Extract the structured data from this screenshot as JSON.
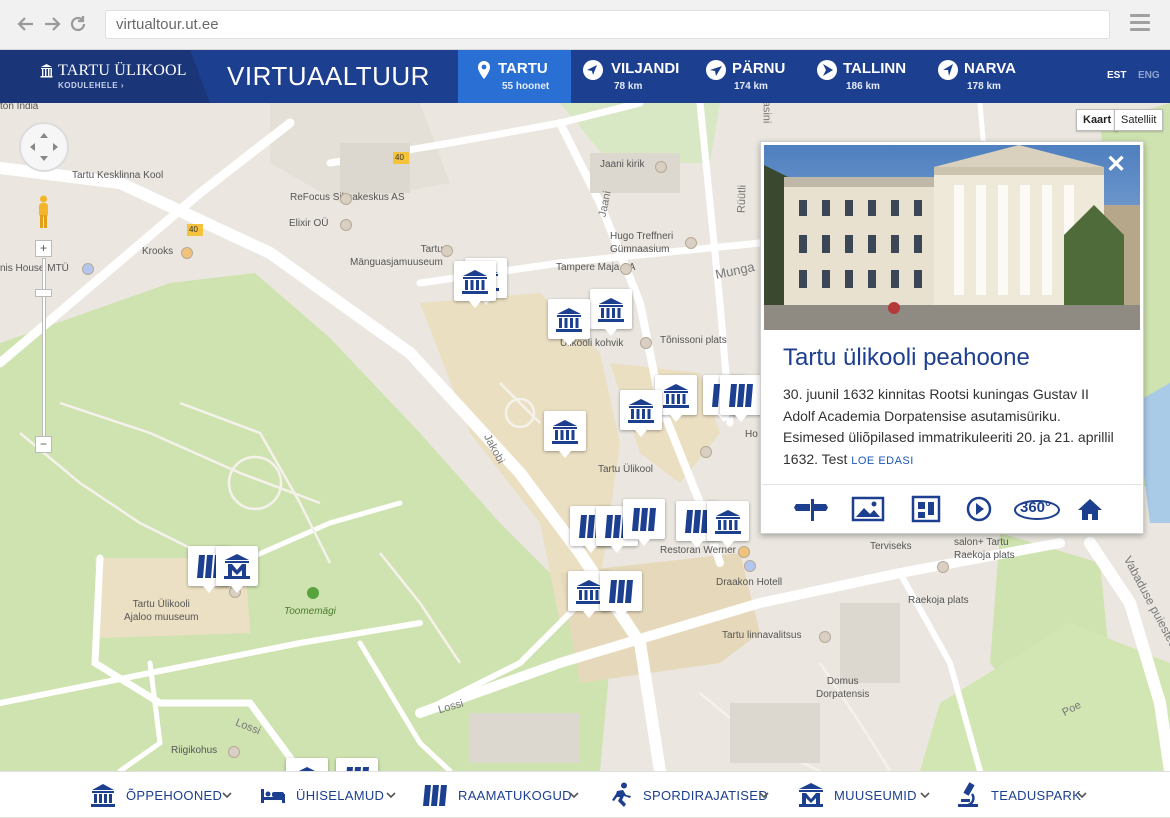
{
  "browser": {
    "url": "virtualtour.ut.ee"
  },
  "header": {
    "logo_title": "TARTU ÜLIKOOL",
    "logo_sub": "KODULEHELE ›",
    "site_title": "VIRTUAALTUUR",
    "cities": [
      {
        "name": "TARTU",
        "sub": "55 hoonet",
        "active": true
      },
      {
        "name": "VILJANDI",
        "sub": "78 km"
      },
      {
        "name": "PÄRNU",
        "sub": "174 km"
      },
      {
        "name": "TALLINN",
        "sub": "186 km"
      },
      {
        "name": "NARVA",
        "sub": "178 km"
      }
    ],
    "lang_est": "EST",
    "lang_eng": "ENG"
  },
  "map": {
    "map_type_map": "Kaart",
    "map_type_satellite": "Satelliit",
    "zoom_in": "+",
    "zoom_out": "−",
    "road_number": "40",
    "labels": {
      "toomemagi": "Toomemägi",
      "jaani_kirik": "Jaani kirik",
      "kesklinna_kool": "Tartu Kesklinna Kool",
      "refocus": "ReFocus Silmakeskus AS",
      "elixir": "Elixir OÜ",
      "krooks": "Krooks",
      "nis_house": "nis House MTÜ",
      "manguasja": "Tartu\nMänguasjamuuseum",
      "treffneri": "Hugo Treffneri\nGümnaasium",
      "tampere": "Tampere Maja SA",
      "kohvik": "Ülikooli kohvik",
      "tonissoni": "Tõnissoni plats",
      "ulikool": "Tartu Ülikool",
      "werner": "Restoran Werner",
      "ajaloo": "Tartu Ülikooli\nAjaloo muuseum",
      "draakon": "Draakon Hotell",
      "linnavalitsus": "Tartu linnavalitsus",
      "domus": "Domus\nDorpatensis",
      "raekoja": "Raekoja plats",
      "salon": "salon+ Tartu\nRaekoja plats",
      "terviseks": "Terviseks",
      "riigikohus": "Riigikohus",
      "london": "ton India",
      "ho": "Ho"
    },
    "streets": {
      "jakobi": "Jakobi",
      "jaani": "Jaani",
      "ruutli": "Rüütli",
      "munga": "Munga",
      "lossi": "Lossi",
      "lossi2": "Lossi",
      "vabaduse": "Vabaduse puiestee",
      "poe": "Poe",
      "gasini": "gasini"
    }
  },
  "card": {
    "title": "Tartu ülikooli peahoone",
    "text": "30. juunil 1632 kinnitas Rootsi kuningas Gustav II Adolf Academia Dorpatensise asutamisüriku. Esimesed üliõpilased immatrikuleeriti 20. ja 21. aprillil 1632. Test",
    "read_more": "LOE EDASI",
    "close": "✕",
    "degrees": "360°"
  },
  "categories": [
    {
      "label": "ÕPPEHOONED",
      "icon": "building-columns-icon"
    },
    {
      "label": "ÜHISELAMUD",
      "icon": "bed-icon"
    },
    {
      "label": "RAAMATUKOGUD",
      "icon": "books-icon"
    },
    {
      "label": "SPORDIRAJATISED",
      "icon": "runner-icon"
    },
    {
      "label": "MUUSEUMID",
      "icon": "museum-icon"
    },
    {
      "label": "TEADUSPARK",
      "icon": "microscope-icon"
    }
  ],
  "colors": {
    "brand": "#1d3f8f",
    "active_tab": "#2a6fd4",
    "park": "#c9dfa8",
    "road": "#ffffff",
    "campus": "#ebdfc3"
  }
}
